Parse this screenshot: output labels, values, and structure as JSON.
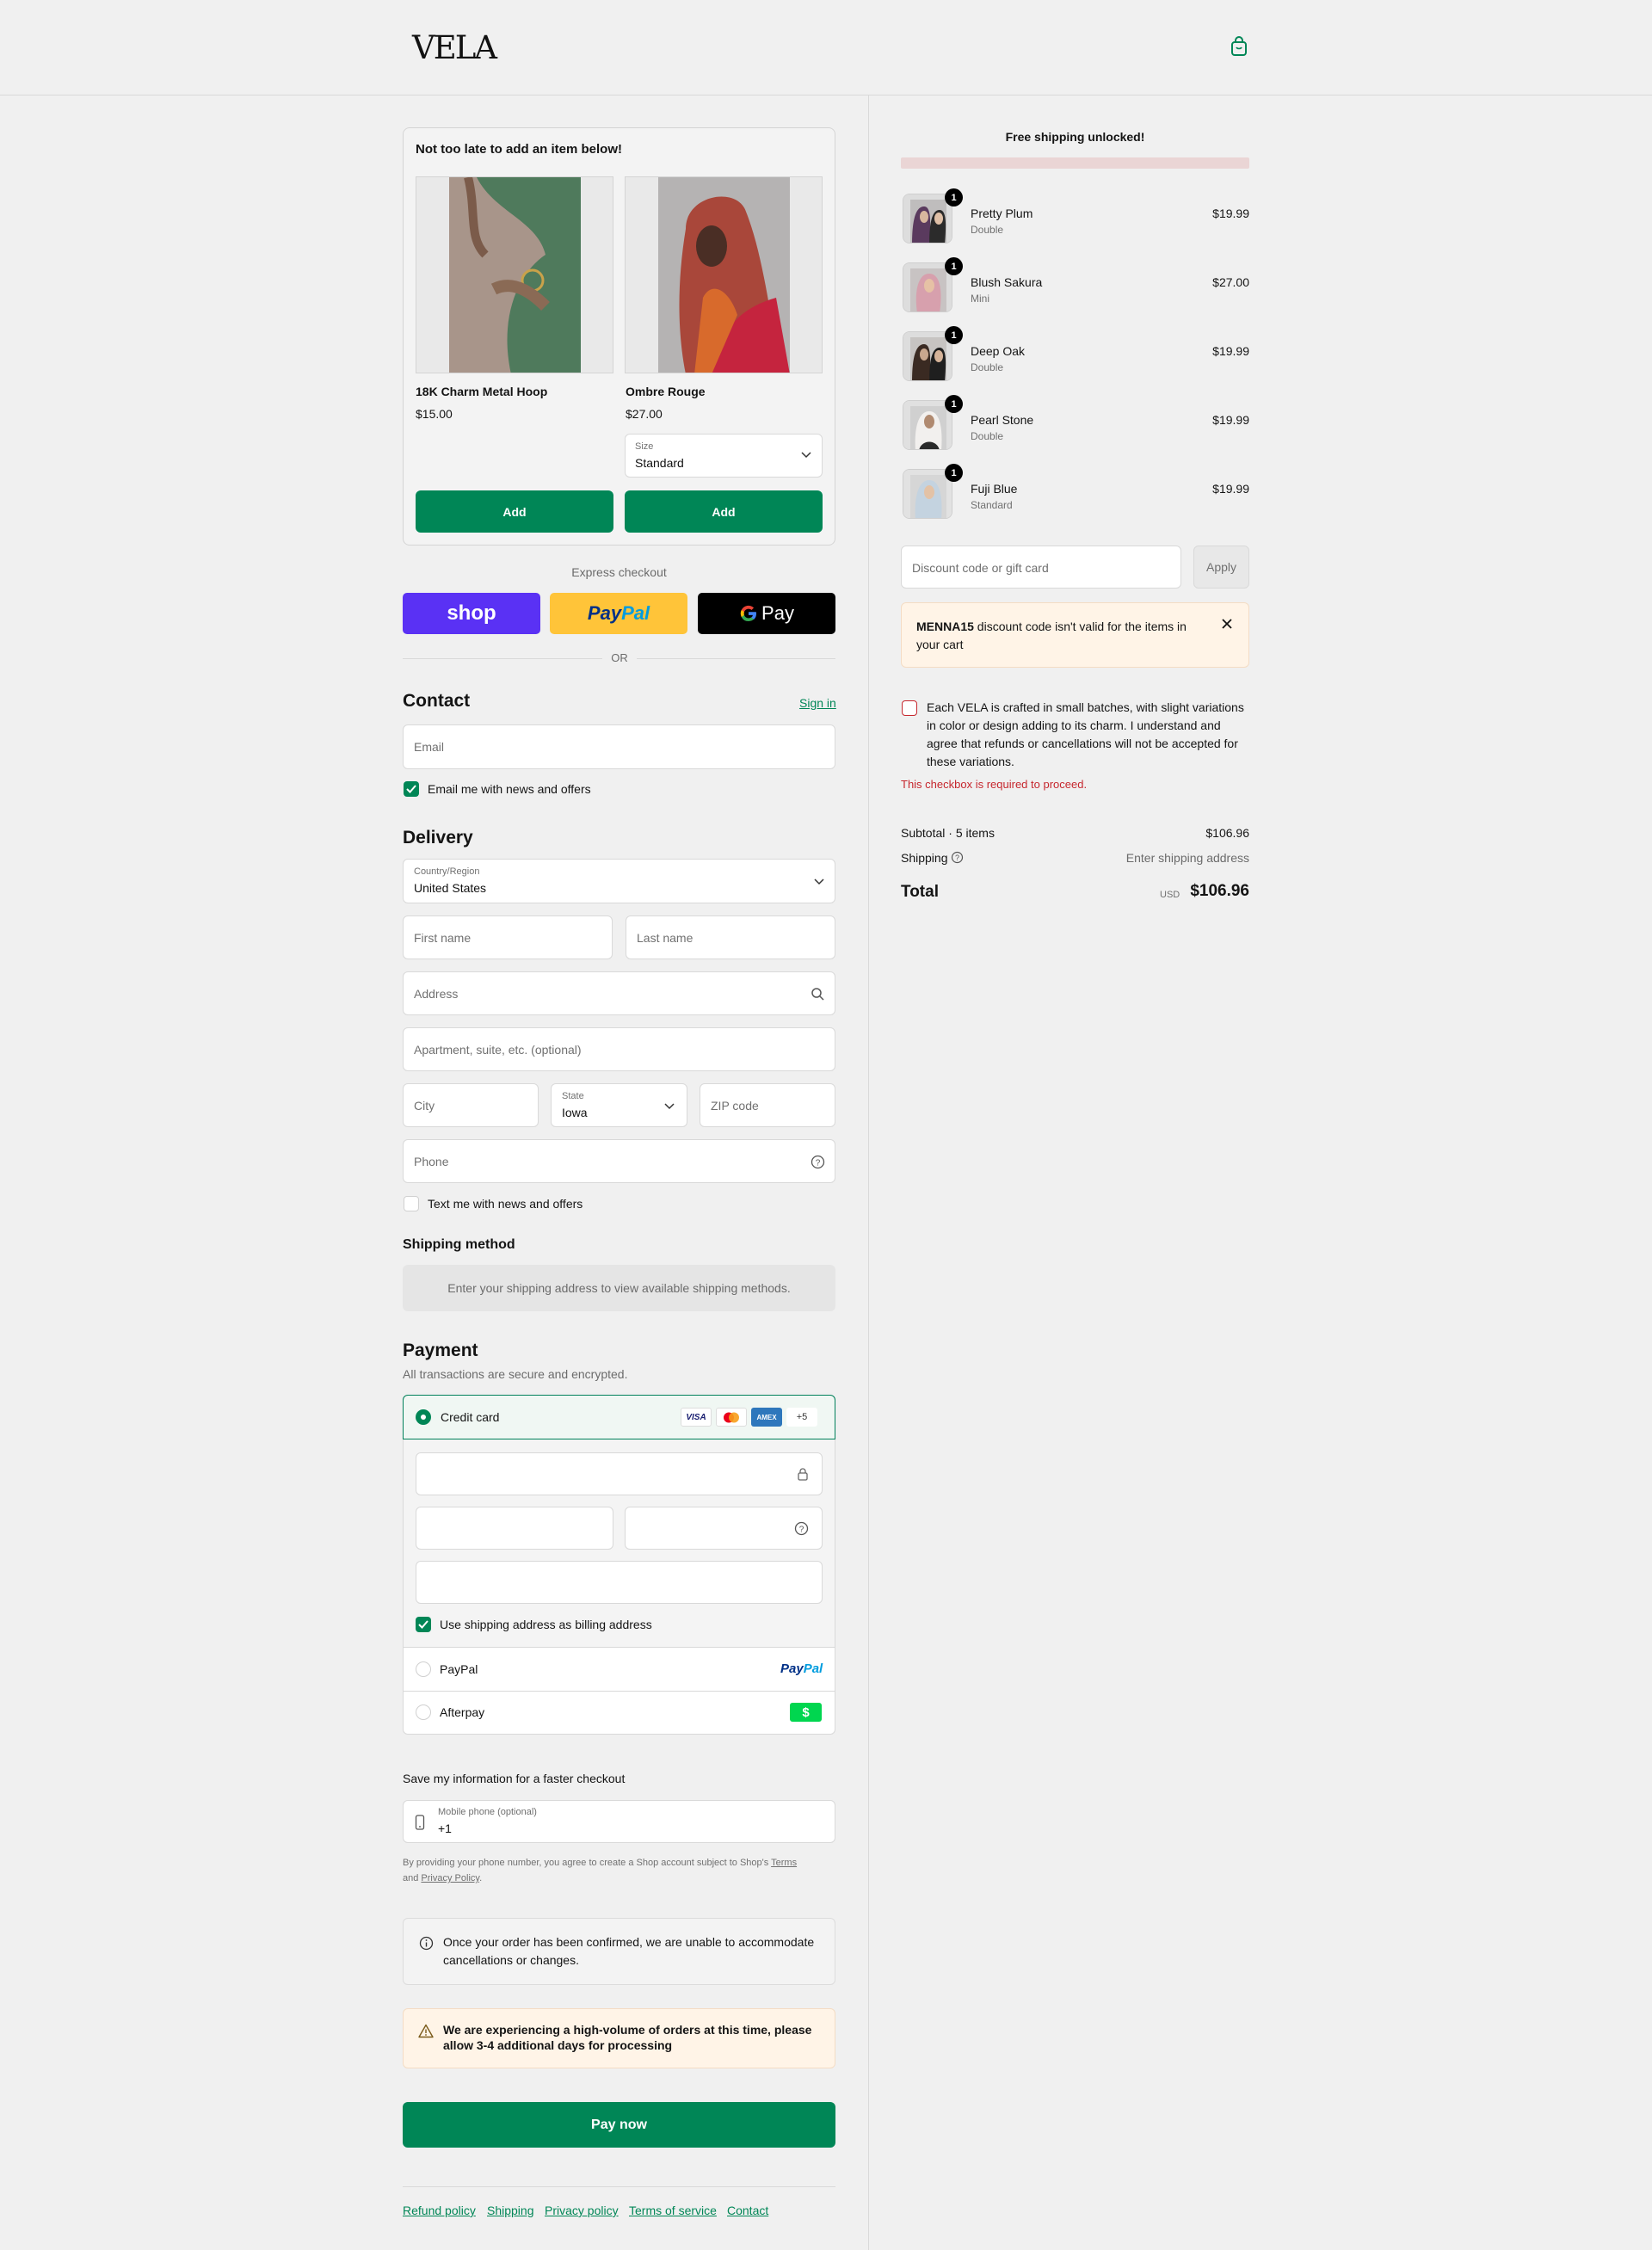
{
  "header": {
    "logo": "VELA",
    "cart_icon": "shopping-bag-icon"
  },
  "upsell": {
    "title": "Not too late to add an item below!",
    "products": [
      {
        "name": "18K Charm Metal Hoop",
        "price": "$15.00",
        "button": "Add"
      },
      {
        "name": "Ombre Rouge",
        "price": "$27.00",
        "size_label": "Size",
        "size_value": "Standard",
        "button": "Add"
      }
    ]
  },
  "express": {
    "label": "Express checkout",
    "shop": "shop",
    "paypal_pay": "Pay",
    "paypal_pal": "Pal",
    "gpay": "Pay",
    "or": "OR"
  },
  "contact": {
    "title": "Contact",
    "sign_in": "Sign in",
    "email_placeholder": "Email",
    "news_label": "Email me with news and offers"
  },
  "delivery": {
    "title": "Delivery",
    "country_label": "Country/Region",
    "country_value": "United States",
    "first_name": "First name",
    "last_name": "Last name",
    "address": "Address",
    "apartment": "Apartment, suite, etc. (optional)",
    "city": "City",
    "state_label": "State",
    "state_value": "Iowa",
    "zip": "ZIP code",
    "phone": "Phone",
    "text_label": "Text me with news and offers"
  },
  "shipping_method": {
    "title": "Shipping method",
    "message": "Enter your shipping address to view available shipping methods."
  },
  "payment": {
    "title": "Payment",
    "subtitle": "All transactions are secure and encrypted.",
    "credit_card": "Credit card",
    "card_logos": [
      "VISA",
      "mastercard",
      "AMEX"
    ],
    "more_cards": "+5",
    "billing_label": "Use shipping address as billing address",
    "paypal": "PayPal",
    "paypal_logo_pay": "Pay",
    "paypal_logo_pal": "Pal",
    "afterpay": "Afterpay",
    "afterpay_logo": "$"
  },
  "save_info": {
    "title": "Save my information for a faster checkout",
    "mobile_label": "Mobile phone (optional)",
    "mobile_value": "+1",
    "legal_prefix": "By providing your phone number, you agree to create a Shop account subject to Shop's",
    "terms": "Terms",
    "and": "and",
    "privacy": "Privacy Policy",
    "period": "."
  },
  "notices": {
    "info": "Once your order has been confirmed, we are unable to accommodate cancellations or changes.",
    "warning": "We are experiencing a high-volume of orders at this time, please allow 3-4 additional days for processing"
  },
  "pay_now": "Pay now",
  "footer": [
    "Refund policy",
    "Shipping",
    "Privacy policy",
    "Terms of service",
    "Contact"
  ],
  "summary": {
    "ship_banner": "Free shipping unlocked!",
    "items": [
      {
        "name": "Pretty Plum",
        "variant": "Double",
        "price": "$19.99",
        "qty": "1"
      },
      {
        "name": "Blush Sakura",
        "variant": "Mini",
        "price": "$27.00",
        "qty": "1"
      },
      {
        "name": "Deep Oak",
        "variant": "Double",
        "price": "$19.99",
        "qty": "1"
      },
      {
        "name": "Pearl Stone",
        "variant": "Double",
        "price": "$19.99",
        "qty": "1"
      },
      {
        "name": "Fuji Blue",
        "variant": "Standard",
        "price": "$19.99",
        "qty": "1"
      }
    ],
    "discount_placeholder": "Discount code or gift card",
    "apply": "Apply",
    "discount_code": "MENNA15",
    "discount_error": "discount code isn't valid for the items in your cart",
    "consent": "Each VELA is crafted in small batches, with slight variations in color or design adding to its charm. I understand and agree that refunds or cancellations will not be accepted for these variations.",
    "consent_error": "This checkbox is required to proceed.",
    "subtotal_label": "Subtotal · 5 items",
    "subtotal": "$106.96",
    "shipping_label": "Shipping",
    "shipping_value": "Enter shipping address",
    "total_label": "Total",
    "currency": "USD",
    "total": "$106.96"
  },
  "colors": {
    "accent": "#008656",
    "error": "#c6272e",
    "shop": "#5a31f4",
    "paypal": "#ffc439"
  }
}
